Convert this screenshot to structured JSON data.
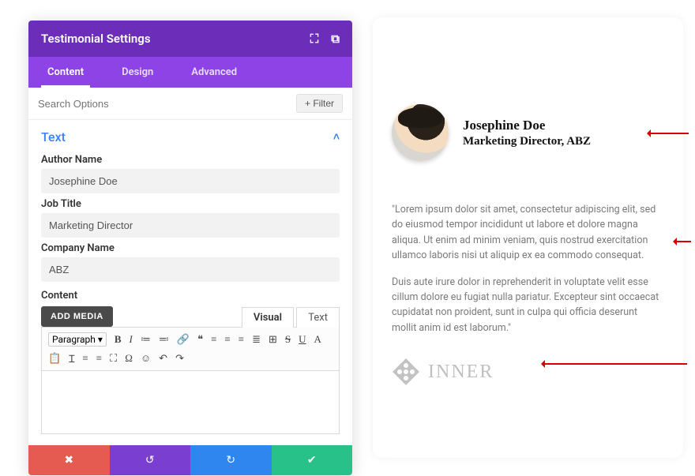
{
  "header": {
    "title": "Testimonial Settings"
  },
  "tabs": {
    "content": "Content",
    "design": "Design",
    "advanced": "Advanced"
  },
  "search": {
    "placeholder": "Search Options",
    "filter": "+  Filter"
  },
  "section": {
    "title": "Text"
  },
  "fields": {
    "author": {
      "label": "Author Name",
      "value": "Josephine Doe"
    },
    "job": {
      "label": "Job Title",
      "value": "Marketing Director"
    },
    "company": {
      "label": "Company Name",
      "value": "ABZ"
    }
  },
  "content": {
    "label": "Content",
    "addMedia": "ADD MEDIA",
    "editorTabs": {
      "visual": "Visual",
      "text": "Text"
    },
    "paragraphSelect": "Paragraph"
  },
  "toolbar": {
    "items": [
      "B",
      "I",
      "≔",
      "≕",
      "🔗",
      "❝",
      "≡",
      "≡",
      "≡",
      "≣",
      "⊞",
      "S",
      "U",
      "A",
      "📋",
      "Ɪ",
      "≡",
      "≡",
      "⛶",
      "Ω",
      "☺",
      "↶",
      "↷"
    ]
  },
  "preview": {
    "name": "Josephine Doe",
    "title": "Marketing Director, ABZ",
    "p1": "\"Lorem ipsum dolor sit amet, consectetur adipiscing elit, sed do eiusmod tempor incididunt ut labore et dolore magna aliqua. Ut enim ad minim veniam, quis nostrud exercitation ullamco laboris nisi ut aliquip ex ea commodo consequat.",
    "p2": "Duis aute irure dolor in reprehenderit in voluptate velit esse cillum dolore eu fugiat nulla pariatur. Excepteur sint occaecat cupidatat non proident, sunt in culpa qui officia deserunt mollit anim id est laborum.\"",
    "logoText": "INNER"
  }
}
